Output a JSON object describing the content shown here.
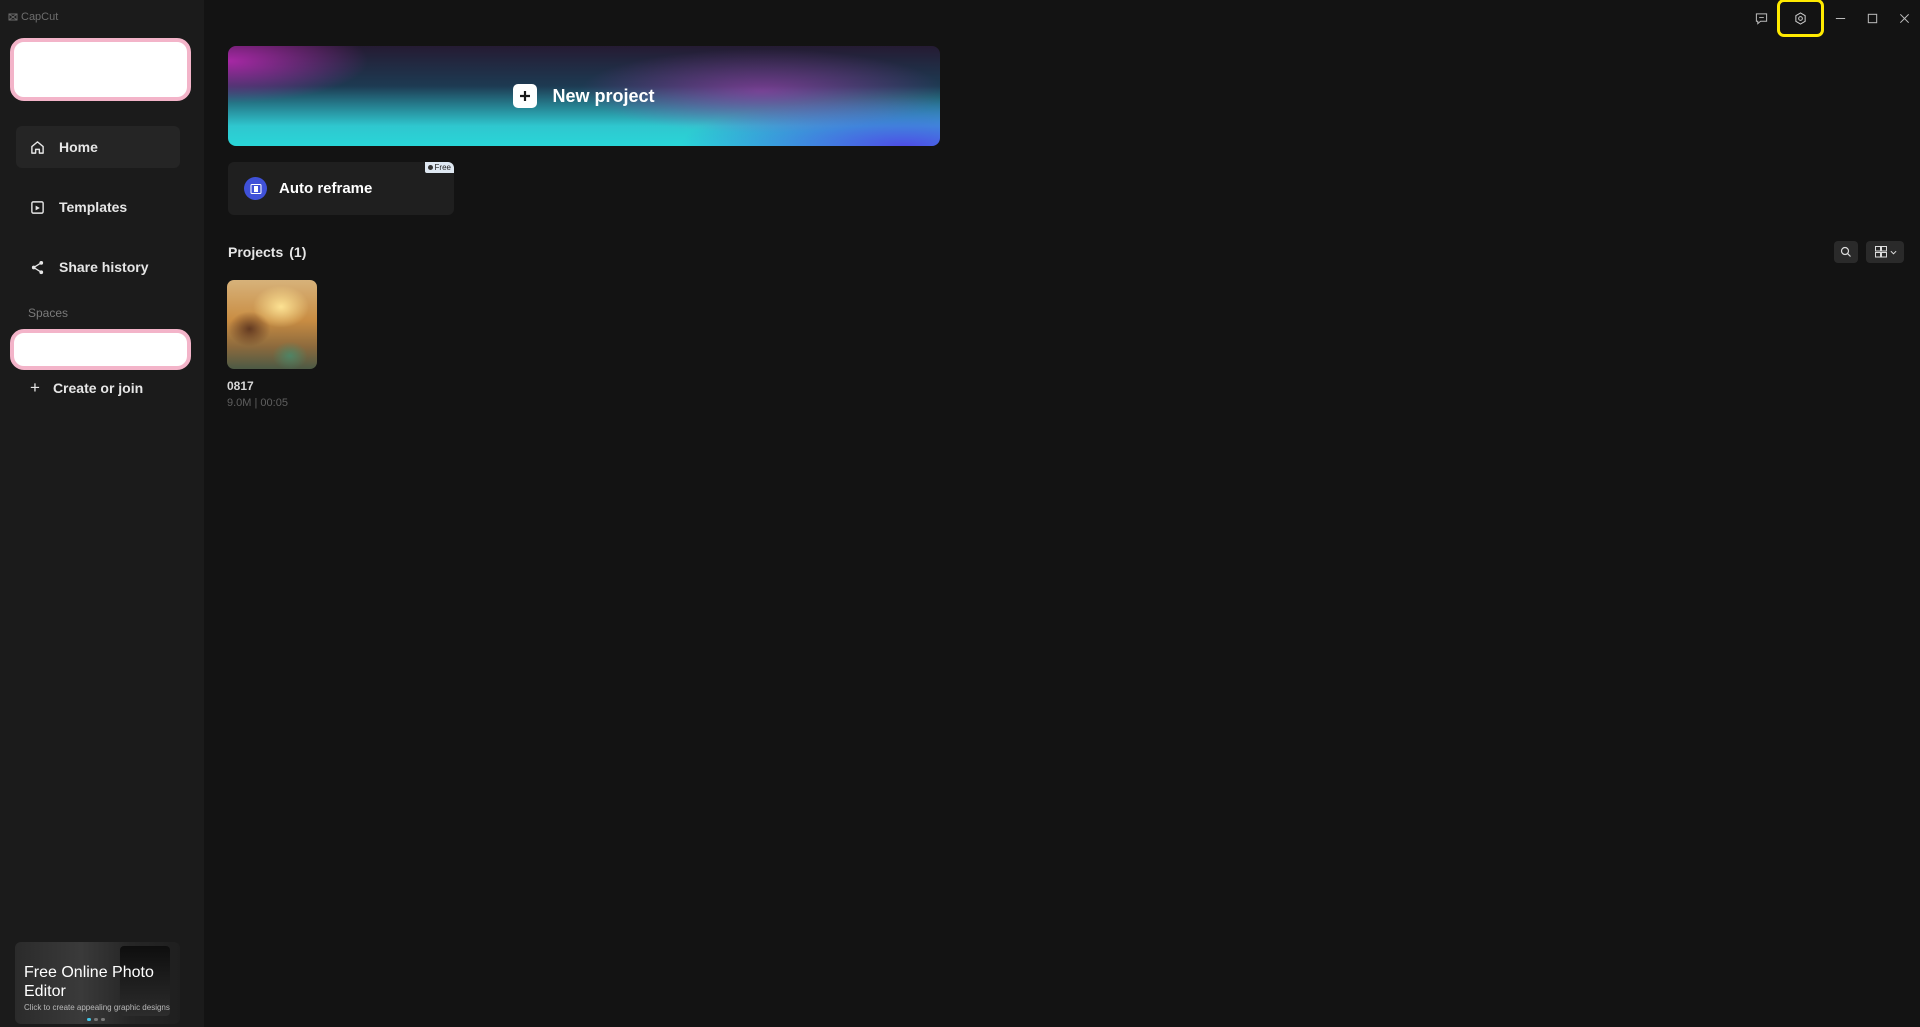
{
  "app": {
    "title": "CapCut"
  },
  "sidebar": {
    "items": [
      {
        "label": "Home",
        "icon": "home-icon",
        "active": true
      },
      {
        "label": "Templates",
        "icon": "templates-icon",
        "active": false
      },
      {
        "label": "Share history",
        "icon": "share-icon",
        "active": false
      }
    ],
    "spaces_label": "Spaces",
    "create_join_label": "Create or join",
    "promo": {
      "title": "Free Online Photo Editor",
      "subtitle": "Click to create appealing graphic designs"
    }
  },
  "header": {
    "controls": [
      "feedback-icon",
      "settings-icon",
      "minimize-icon",
      "maximize-icon",
      "close-icon"
    ]
  },
  "main": {
    "new_project_label": "New project",
    "auto_reframe_label": "Auto reframe",
    "free_badge": "Free",
    "projects_label": "Projects",
    "projects_count": "(1)",
    "projects": [
      {
        "name": "0817",
        "meta": "9.0M | 00:05"
      }
    ]
  },
  "colors": {
    "background": "#131313",
    "sidebar": "#1b1b1b",
    "accent_highlight": "#ffea00",
    "auto_reframe_icon": "#3f51d8"
  }
}
